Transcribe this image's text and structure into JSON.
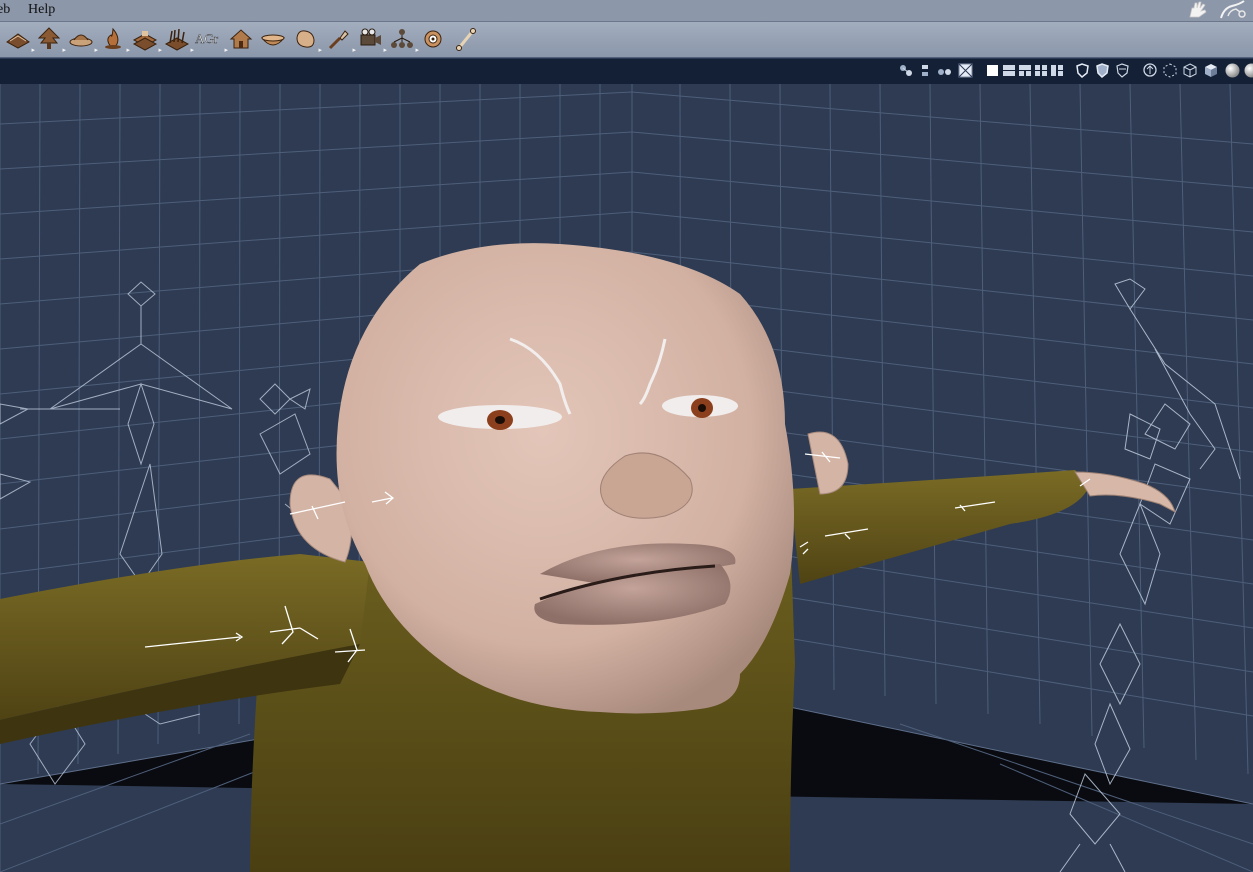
{
  "menubar": {
    "items": [
      {
        "id": "web",
        "label": "eb"
      },
      {
        "id": "help",
        "label": "Help"
      }
    ],
    "corner_icons": [
      "hand-icon",
      "wand-icon"
    ]
  },
  "toolbar": {
    "tools": [
      {
        "name": "ground-plane-tool-icon",
        "flyout": true
      },
      {
        "name": "tree-tool-icon",
        "flyout": true
      },
      {
        "name": "terrain-tool-icon",
        "flyout": true
      },
      {
        "name": "fire-tool-icon",
        "flyout": true
      },
      {
        "name": "layer-stack-tool-icon",
        "flyout": true
      },
      {
        "name": "grass-tool-icon",
        "flyout": true
      },
      {
        "name": "agr-text-tool-icon",
        "label": "AGr",
        "flyout": true
      },
      {
        "name": "house-tool-icon",
        "flyout": false
      },
      {
        "name": "bowl-tool-icon",
        "flyout": false
      },
      {
        "name": "blob-tool-icon",
        "flyout": true
      },
      {
        "name": "brush-tool-icon",
        "flyout": true
      },
      {
        "name": "camera-tool-icon",
        "flyout": true
      },
      {
        "name": "hierarchy-tool-icon",
        "flyout": true
      },
      {
        "name": "target-tool-icon",
        "flyout": false
      },
      {
        "name": "bone-tool-icon",
        "flyout": false
      }
    ]
  },
  "view_header": {
    "icons": [
      "molecule-icon",
      "figure-stack-icon",
      "group-icon",
      "grid-select-icon",
      "single-view-icon",
      "two-view-icon",
      "three-view-icon",
      "four-view-icon",
      "quad-view-icon",
      "shield-a-icon",
      "shield-b-icon",
      "shield-c-icon",
      "arrow-circle-icon",
      "dotted-box-icon",
      "wire-cube-icon",
      "solid-cube-icon",
      "shaded-sphere-icon",
      "shaded-sphere-2-icon"
    ]
  },
  "colors": {
    "menubar_bg": "#8c97aa",
    "toolbar_bg": "#99a4b6",
    "viewport_bg": "#2e3b52",
    "grid_line": "#5f6f8c",
    "skin": "#d6b7a8",
    "shirt": "#5c5019"
  }
}
